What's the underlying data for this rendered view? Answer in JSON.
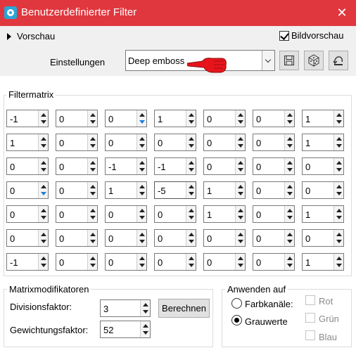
{
  "window": {
    "title": "Benutzerdefinierter Filter"
  },
  "top": {
    "preview_label": "Vorschau",
    "bild_label": "Bildvorschau",
    "bild_checked": true,
    "settings_label": "Einstellungen",
    "preset_value": "Deep emboss"
  },
  "matrix": {
    "title": "Filtermatrix",
    "rows": [
      [
        "-1",
        "0",
        "0",
        "1",
        "0",
        "0",
        "1"
      ],
      [
        "1",
        "0",
        "0",
        "0",
        "0",
        "0",
        "1"
      ],
      [
        "0",
        "0",
        "-1",
        "-1",
        "0",
        "0",
        "0"
      ],
      [
        "0",
        "0",
        "1",
        "-5",
        "1",
        "0",
        "0"
      ],
      [
        "0",
        "0",
        "0",
        "0",
        "1",
        "0",
        "1"
      ],
      [
        "0",
        "0",
        "0",
        "0",
        "0",
        "0",
        "0"
      ],
      [
        "-1",
        "0",
        "0",
        "0",
        "0",
        "0",
        "1"
      ]
    ]
  },
  "modifiers": {
    "title": "Matrixmodifikatoren",
    "division_label": "Divisionsfaktor:",
    "division_value": "3",
    "weight_label": "Gewichtungsfaktor:",
    "weight_value": "52",
    "calc_button": "Berechnen"
  },
  "apply": {
    "title": "Anwenden auf",
    "color_label": "Farbkanäle:",
    "gray_label": "Grauwerte",
    "selected": "Grauwerte",
    "channels": [
      "Rot",
      "Grün",
      "Blau"
    ]
  },
  "colors": {
    "titlebar": "#e0373e",
    "hand": "#e8141c"
  }
}
